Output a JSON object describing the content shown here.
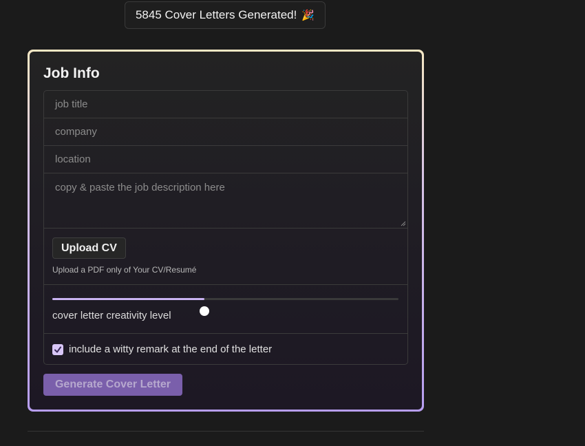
{
  "counter": {
    "text": "5845 Cover Letters Generated!",
    "icon": "party-popper-icon"
  },
  "card": {
    "title": "Job Info",
    "fields": {
      "job_title_placeholder": "job title",
      "company_placeholder": "company",
      "location_placeholder": "location",
      "description_placeholder": "copy & paste the job description here"
    },
    "upload": {
      "button_label": "Upload CV",
      "hint": "Upload a PDF only of Your CV/Resumé"
    },
    "creativity": {
      "label": "cover letter creativity level",
      "level_fraction": 0.44
    },
    "witty": {
      "label": "include a witty remark at the end of the letter",
      "checked": true
    },
    "generate_label": "Generate Cover Letter"
  },
  "colors": {
    "accent": "#b79ef0",
    "button": "#8063b3",
    "checkbox": "#d8c6f7"
  }
}
